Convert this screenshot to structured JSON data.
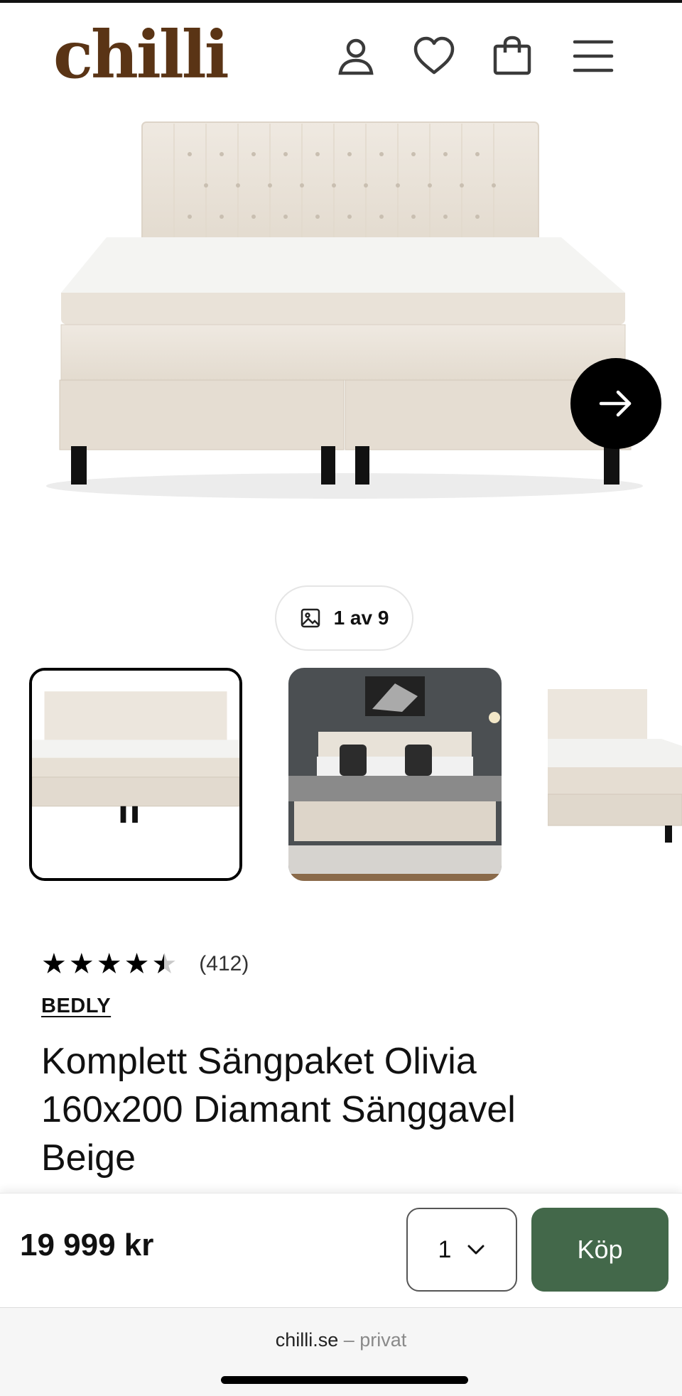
{
  "header": {
    "logo": "chilli",
    "icons": [
      "user-icon",
      "heart-icon",
      "bag-icon",
      "menu-icon"
    ]
  },
  "gallery": {
    "counter_text": "1 av 9",
    "next_icon": "arrow-right-icon",
    "thumbnail_count_visible": 3
  },
  "product": {
    "rating": 4.5,
    "reviews": "(412)",
    "brand": "BEDLY",
    "title": "Komplett Sängpaket Olivia 160x200 Diamant Sänggavel Beige"
  },
  "buybar": {
    "price": "19 999 kr",
    "quantity": "1",
    "buy_label": "Köp"
  },
  "browser": {
    "domain": "chilli.se",
    "suffix": "– privat"
  },
  "colors": {
    "brand": "#5a3415",
    "buy_button": "#43684a",
    "text": "#111111"
  }
}
